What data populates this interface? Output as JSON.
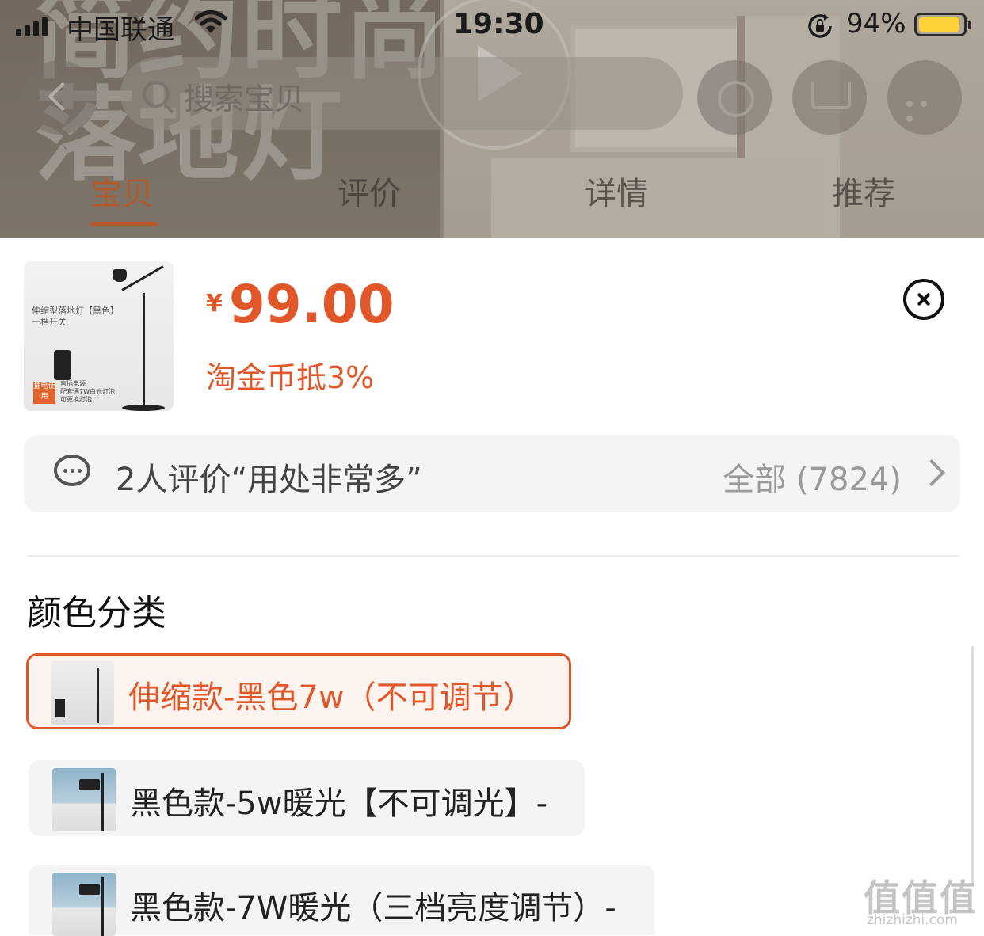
{
  "status_bar": {
    "carrier": "中国联通",
    "time": "19:30",
    "battery_percent": "94%",
    "battery_level": 0.94,
    "icons": [
      "signal-icon",
      "wifi-icon",
      "rotation-lock-icon",
      "battery-icon"
    ]
  },
  "hero": {
    "banner_text": "简约时尚\n落地灯"
  },
  "nav": {
    "search_placeholder": "搜索宝贝",
    "icons": [
      "back-icon",
      "search-icon",
      "play-icon",
      "share-icon",
      "cart-icon",
      "more-icon"
    ]
  },
  "tabs": [
    {
      "label": "宝贝",
      "active": true
    },
    {
      "label": "评价",
      "active": false
    },
    {
      "label": "详情",
      "active": false
    },
    {
      "label": "推荐",
      "active": false
    }
  ],
  "product": {
    "thumbnail_caption": "伸缩型落地灯【黑色】",
    "thumbnail_sub": "一档开关",
    "thumbnail_tag": "插电使用",
    "thumbnail_bullets": [
      "直插电源",
      "配套通7W白光灯泡",
      "可更换灯泡"
    ],
    "currency": "¥",
    "price": "99.00",
    "coin_discount": "淘金币抵3%"
  },
  "review": {
    "summary": "2人评价“用处非常多”",
    "all_label": "全部 (7824)"
  },
  "variants": {
    "section_title": "颜色分类",
    "items": [
      {
        "label": "伸缩款-黑色7w（不可调节）",
        "selected": true
      },
      {
        "label": "黑色款-5w暖光【不可调光】-",
        "selected": false
      },
      {
        "label": "黑色款-7W暖光（三档亮度调节）-",
        "selected": false
      }
    ]
  },
  "watermark": {
    "mark": "值值值",
    "site": "zhizhizhi.com"
  },
  "colors": {
    "accent": "#e0572a",
    "tab_active": "#b35a2a",
    "battery": "#ffd23a"
  }
}
